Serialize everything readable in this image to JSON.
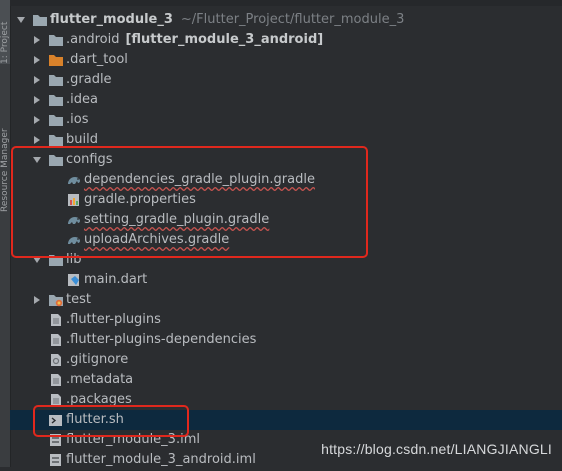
{
  "sidebar": {
    "project_tab": "1: Project",
    "resource_tab": "Resource Manager"
  },
  "root": {
    "name": "flutter_module_3",
    "path": "~/Flutter_Project/flutter_module_3"
  },
  "tree": [
    {
      "label": ".android",
      "suffix": "[flutter_module_3_android]",
      "icon": "folder-icon",
      "expand": "collapsed"
    },
    {
      "label": ".dart_tool",
      "icon": "folder-orange-icon",
      "expand": "collapsed"
    },
    {
      "label": ".gradle",
      "icon": "folder-icon",
      "expand": "collapsed"
    },
    {
      "label": ".idea",
      "icon": "folder-icon",
      "expand": "collapsed"
    },
    {
      "label": ".ios",
      "icon": "folder-icon",
      "expand": "collapsed"
    },
    {
      "label": "build",
      "icon": "folder-icon",
      "expand": "collapsed"
    },
    {
      "label": "configs",
      "icon": "folder-icon",
      "expand": "expanded"
    },
    {
      "label": "dependencies_gradle_plugin.gradle",
      "icon": "gradle-icon"
    },
    {
      "label": "gradle.properties",
      "icon": "properties-icon"
    },
    {
      "label": "setting_gradle_plugin.gradle",
      "icon": "gradle-icon"
    },
    {
      "label": "uploadArchives.gradle",
      "icon": "gradle-icon"
    },
    {
      "label": "lib",
      "icon": "folder-icon",
      "expand": "expanded"
    },
    {
      "label": "main.dart",
      "icon": "dart-file-icon"
    },
    {
      "label": "test",
      "icon": "test-folder-icon",
      "expand": "collapsed"
    },
    {
      "label": ".flutter-plugins",
      "icon": "file-icon"
    },
    {
      "label": ".flutter-plugins-dependencies",
      "icon": "file-icon"
    },
    {
      "label": ".gitignore",
      "icon": "gitignore-icon"
    },
    {
      "label": ".metadata",
      "icon": "file-icon"
    },
    {
      "label": ".packages",
      "icon": "file-icon"
    },
    {
      "label": "flutter.sh",
      "icon": "shell-script-icon"
    },
    {
      "label": "flutter_module_3.iml",
      "icon": "iml-file-icon"
    },
    {
      "label": "flutter_module_3_android.iml",
      "icon": "iml-file-icon"
    }
  ],
  "watermark": "https://blog.csdn.net/LIANGJIANGLI",
  "colors": {
    "background": "#2b2d30",
    "selection": "#0d293e",
    "highlight_box": "#e0281d",
    "folder": "#9aa7b0",
    "folder_orange": "#d9822b"
  }
}
